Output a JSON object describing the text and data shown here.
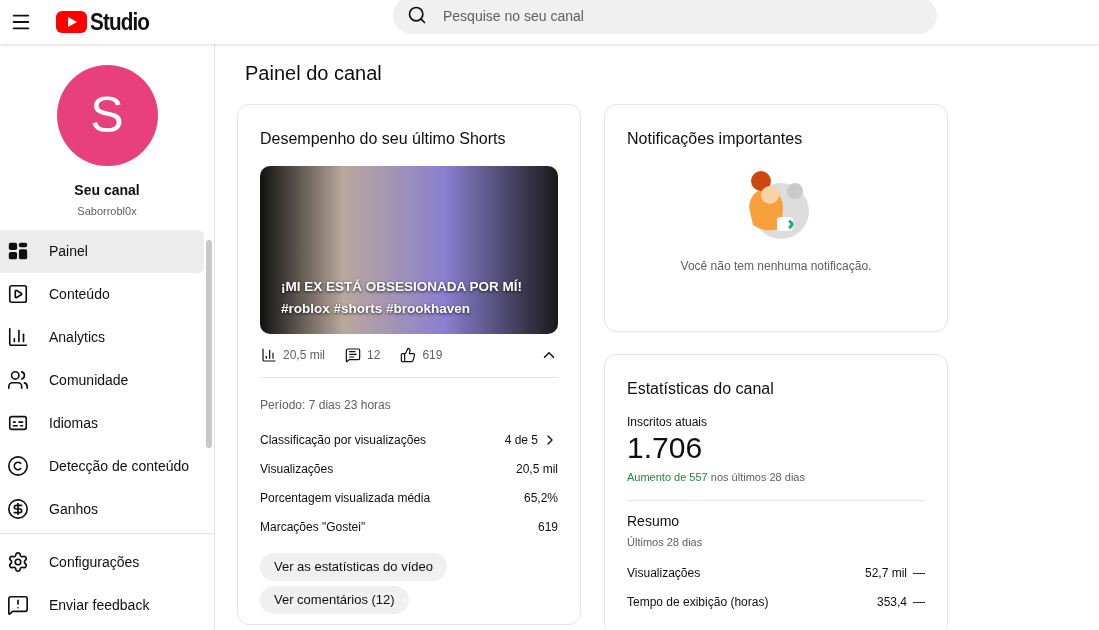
{
  "header": {
    "logo_text": "Studio",
    "search": {
      "placeholder": "Pesquise no seu canal"
    }
  },
  "channel": {
    "avatar_letter": "S",
    "title": "Seu canal",
    "handle": "Saborrobl0x"
  },
  "sidebar": {
    "items": [
      {
        "label": "Painel",
        "selected": true
      },
      {
        "label": "Conteúdo",
        "selected": false
      },
      {
        "label": "Analytics",
        "selected": false
      },
      {
        "label": "Comunidade",
        "selected": false
      },
      {
        "label": "Idiomas",
        "selected": false
      },
      {
        "label": "Detecção de conteúdo",
        "selected": false
      },
      {
        "label": "Ganhos",
        "selected": false
      }
    ],
    "footer_items": [
      {
        "label": "Configurações"
      },
      {
        "label": "Enviar feedback"
      }
    ]
  },
  "page_title": "Painel do canal",
  "shorts_card": {
    "title": "Desempenho do seu último Shorts",
    "video_title": "¡MI EX ESTÁ OBSESIONADA POR MÍ! #roblox #shorts #brookhaven",
    "metrics": [
      "20,5 mil",
      "12",
      "619"
    ],
    "expanded": true,
    "period": "Período: 7 dias 23 horas",
    "rows": [
      {
        "label": "Classificação por visualizações",
        "value": "4 de 5",
        "link": true
      },
      {
        "label": "Visualizações",
        "value": "20,5 mil",
        "link": false
      },
      {
        "label": "Porcentagem visualizada média",
        "value": "65,2%",
        "link": false
      },
      {
        "label": "Marcações \"Gostei\"",
        "value": "619",
        "link": false
      }
    ],
    "buttons": [
      "Ver as estatísticas do vídeo",
      "Ver comentários (12)"
    ]
  },
  "notifications_card": {
    "title": "Notificações importantes",
    "empty_text": "Você não tem nenhuma notificação."
  },
  "stats_card": {
    "title": "Estatísticas do canal",
    "subscribers_label": "Inscritos atuais",
    "subscribers": "1.706",
    "growth_highlight": "Aumento de 557",
    "growth_rest": "nos últimos 28 dias",
    "summary_title": "Resumo",
    "summary_period": "Últimos 28 dias",
    "rows": [
      {
        "label": "Visualizações",
        "value": "52,7 mil",
        "trend": "—"
      },
      {
        "label": "Tempo de exibição (horas)",
        "value": "353,4",
        "trend": "—"
      }
    ]
  }
}
